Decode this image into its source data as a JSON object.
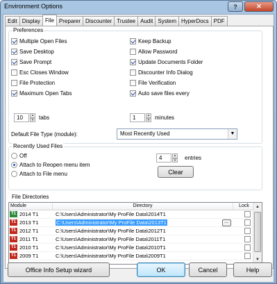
{
  "window": {
    "title": "Environment Options",
    "help": "?",
    "close": "✕"
  },
  "tabs": [
    {
      "label": "Edit"
    },
    {
      "label": "Display"
    },
    {
      "label": "File",
      "active": true
    },
    {
      "label": "Preparer"
    },
    {
      "label": "Discounter"
    },
    {
      "label": "Trustee"
    },
    {
      "label": "Audit"
    },
    {
      "label": "System"
    },
    {
      "label": "HyperDocs"
    },
    {
      "label": "PDF"
    }
  ],
  "preferences": {
    "legend": "Preferences",
    "left": [
      {
        "label": "Multiple Open Files",
        "checked": true
      },
      {
        "label": "Save Desktop",
        "checked": true
      },
      {
        "label": "Save Prompt",
        "checked": true
      },
      {
        "label": "Esc Closes Window",
        "checked": false
      },
      {
        "label": "File Protection",
        "checked": false
      },
      {
        "label": "Maximum Open Tabs",
        "checked": true
      }
    ],
    "right": [
      {
        "label": "Keep Backup",
        "checked": true
      },
      {
        "label": "Allow Password",
        "checked": false
      },
      {
        "label": "Update Documents Folder",
        "checked": true
      },
      {
        "label": "Discounter Info Dialog",
        "checked": false
      },
      {
        "label": "File Verification",
        "checked": false
      },
      {
        "label": "Auto save files every",
        "checked": true
      }
    ],
    "tabs_value": "10",
    "tabs_unit": "tabs",
    "minutes_value": "1",
    "minutes_unit": "minutes",
    "default_type_label": "Default File Type (module):",
    "default_type_value": "Most Recently Used"
  },
  "recent": {
    "legend": "Recently Used Files",
    "options": [
      {
        "label": "Off",
        "checked": false
      },
      {
        "label": "Attach to Reopen menu item",
        "checked": true
      },
      {
        "label": "Attach to File menu",
        "checked": false
      }
    ],
    "entries_value": "4",
    "entries_unit": "entries",
    "clear": "Clear"
  },
  "directories": {
    "legend": "File Directories",
    "headers": {
      "module": "Module",
      "directory": "Directory",
      "lock": "Lock"
    },
    "rows": [
      {
        "module": "2014 T1",
        "icon_color": "#2e8b3a",
        "icon": "T1",
        "dir": "C:\\Users\\Administrator\\My ProFile Data\\2014T1",
        "selected": false
      },
      {
        "module": "2013 T1",
        "icon_color": "#c0281c",
        "icon": "T1",
        "dir": "C:\\Users\\Administrator\\My ProFile Data\\2013T1",
        "selected": true
      },
      {
        "module": "2012 T1",
        "icon_color": "#c0281c",
        "icon": "T1",
        "dir": "C:\\Users\\Administrator\\My ProFile Data\\2012T1",
        "selected": false
      },
      {
        "module": "2011 T1",
        "icon_color": "#c0281c",
        "icon": "T1",
        "dir": "C:\\Users\\Administrator\\My ProFile Data\\2011T1",
        "selected": false
      },
      {
        "module": "2010 T1",
        "icon_color": "#c0281c",
        "icon": "T1",
        "dir": "C:\\Users\\Administrator\\My ProFile Data\\2010T1",
        "selected": false
      },
      {
        "module": "2009 T1",
        "icon_color": "#c0281c",
        "icon": "T1",
        "dir": "C:\\Users\\Administrator\\My ProFile Data\\2009T1",
        "selected": false
      }
    ],
    "dots": "..."
  },
  "footer": {
    "wizard": "Office Info Setup wizard",
    "ok": "OK",
    "cancel": "Cancel",
    "help": "Help"
  }
}
